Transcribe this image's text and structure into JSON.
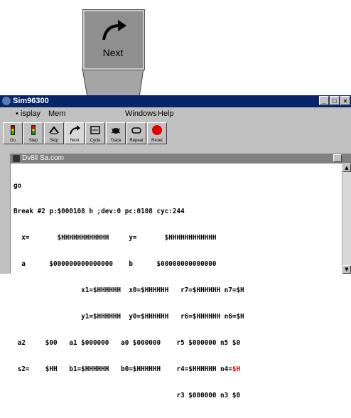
{
  "callout": {
    "label": "Next"
  },
  "window": {
    "title": "Sim96300"
  },
  "menu": [
    {
      "label": "Display",
      "shown": "•   isplay"
    },
    {
      "label": "Mem",
      "shown": "Mem"
    },
    {
      "label": "Windows",
      "shown": "Windows"
    },
    {
      "label": "Help",
      "shown": "Help"
    }
  ],
  "toolbar": [
    {
      "label": "Go",
      "icon": "traffic-light-green-icon"
    },
    {
      "label": "Step",
      "icon": "traffic-light-red-icon"
    },
    {
      "label": "Skip",
      "icon": "skip-icon"
    },
    {
      "label": "Next",
      "icon": "next-arrow-icon"
    },
    {
      "label": "Cycle",
      "icon": "cycle-icon"
    },
    {
      "label": "Trace",
      "icon": "bug-icon"
    },
    {
      "label": "Repeat",
      "icon": "repeat-icon"
    },
    {
      "label": "Reset",
      "icon": "stop-icon"
    }
  ],
  "debug": {
    "title": "Dv8ll Sa.com",
    "prompt": "go",
    "status": "Break #2 p:$000108 h ;dev:0 pc:0108 cyc:244",
    "lines": [
      [
        "  x=       $HHHHHHHHHHHH     y=       $HHHHHHHHHHHH"
      ],
      [
        "  a      $000000000000000    b      $00000000000000"
      ],
      [
        "                 x1=$HHHHHH  x0=$HHHHHH   r7=$HHHHHH n7=$H"
      ],
      [
        "                 y1=$HHHHHH  y0=$HHHHHH   r6=$HHHHHH n6=$H"
      ],
      [
        " a2     $00   a1 $000000   a0 $000000    r5 $000000 n5 $0"
      ],
      [
        " s2=    $HH   b1=$HHHHHH   b0=$HHHHHH    r4=$HHHHHH n4=",
        "$H"
      ],
      [
        "                                         r3 $000000 n3 $0"
      ]
    ]
  },
  "colors": {
    "titlebar": "#08246b",
    "chrome": "#c0c0c0",
    "highlight": "#d40000"
  }
}
